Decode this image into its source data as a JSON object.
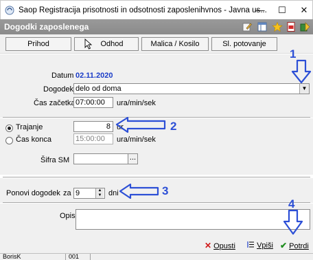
{
  "window": {
    "title": "Saop Registracija prisotnosti in odsotnosti zaposlenihvnos - Javna us...",
    "minimize_glyph": "—",
    "maximize_glyph": "☐",
    "close_glyph": "✕"
  },
  "header": {
    "title": "Dogodki zaposlenega"
  },
  "toolbar": {
    "prihod": "Prihod",
    "odhod": "Odhod",
    "malica": "Malica / Kosilo",
    "potovanje": "Sl. potovanje"
  },
  "form": {
    "datum_label": "Datum",
    "datum_value": "02.11.2020",
    "dogodek_label": "Dogodek",
    "dogodek_value": "delo od doma",
    "cas_zacetka_label": "Čas začetka",
    "cas_zacetka_value": "07:00:00",
    "cas_zacetka_unit": "ura/min/sek",
    "trajanje_label": "Trajanje",
    "trajanje_value": "8",
    "trajanje_unit": "ur",
    "cas_konca_label": "Čas konca",
    "cas_konca_value": "15:00:00",
    "cas_konca_unit": "ura/min/sek",
    "sifra_label": "Šifra SM",
    "sifra_value": "",
    "sifra_btn": "...",
    "ponovi_label": "Ponovi dogodek",
    "ponovi_za": "za",
    "ponovi_value": "9",
    "ponovi_unit": "dni",
    "opis_label": "Opis",
    "opis_value": ""
  },
  "annotations": {
    "n1": "1",
    "n2": "2",
    "n3": "3",
    "n4": "4"
  },
  "actions": {
    "opusti": "Opusti",
    "vpisi": "Vpiši",
    "potrdi": "Potrdi"
  },
  "status": {
    "user": "BorisK",
    "code": "001"
  },
  "colors": {
    "annotation": "#2c4fd6",
    "date": "#1a3cc8",
    "confirm": "#1e8c1e",
    "cancel": "#d01818"
  }
}
